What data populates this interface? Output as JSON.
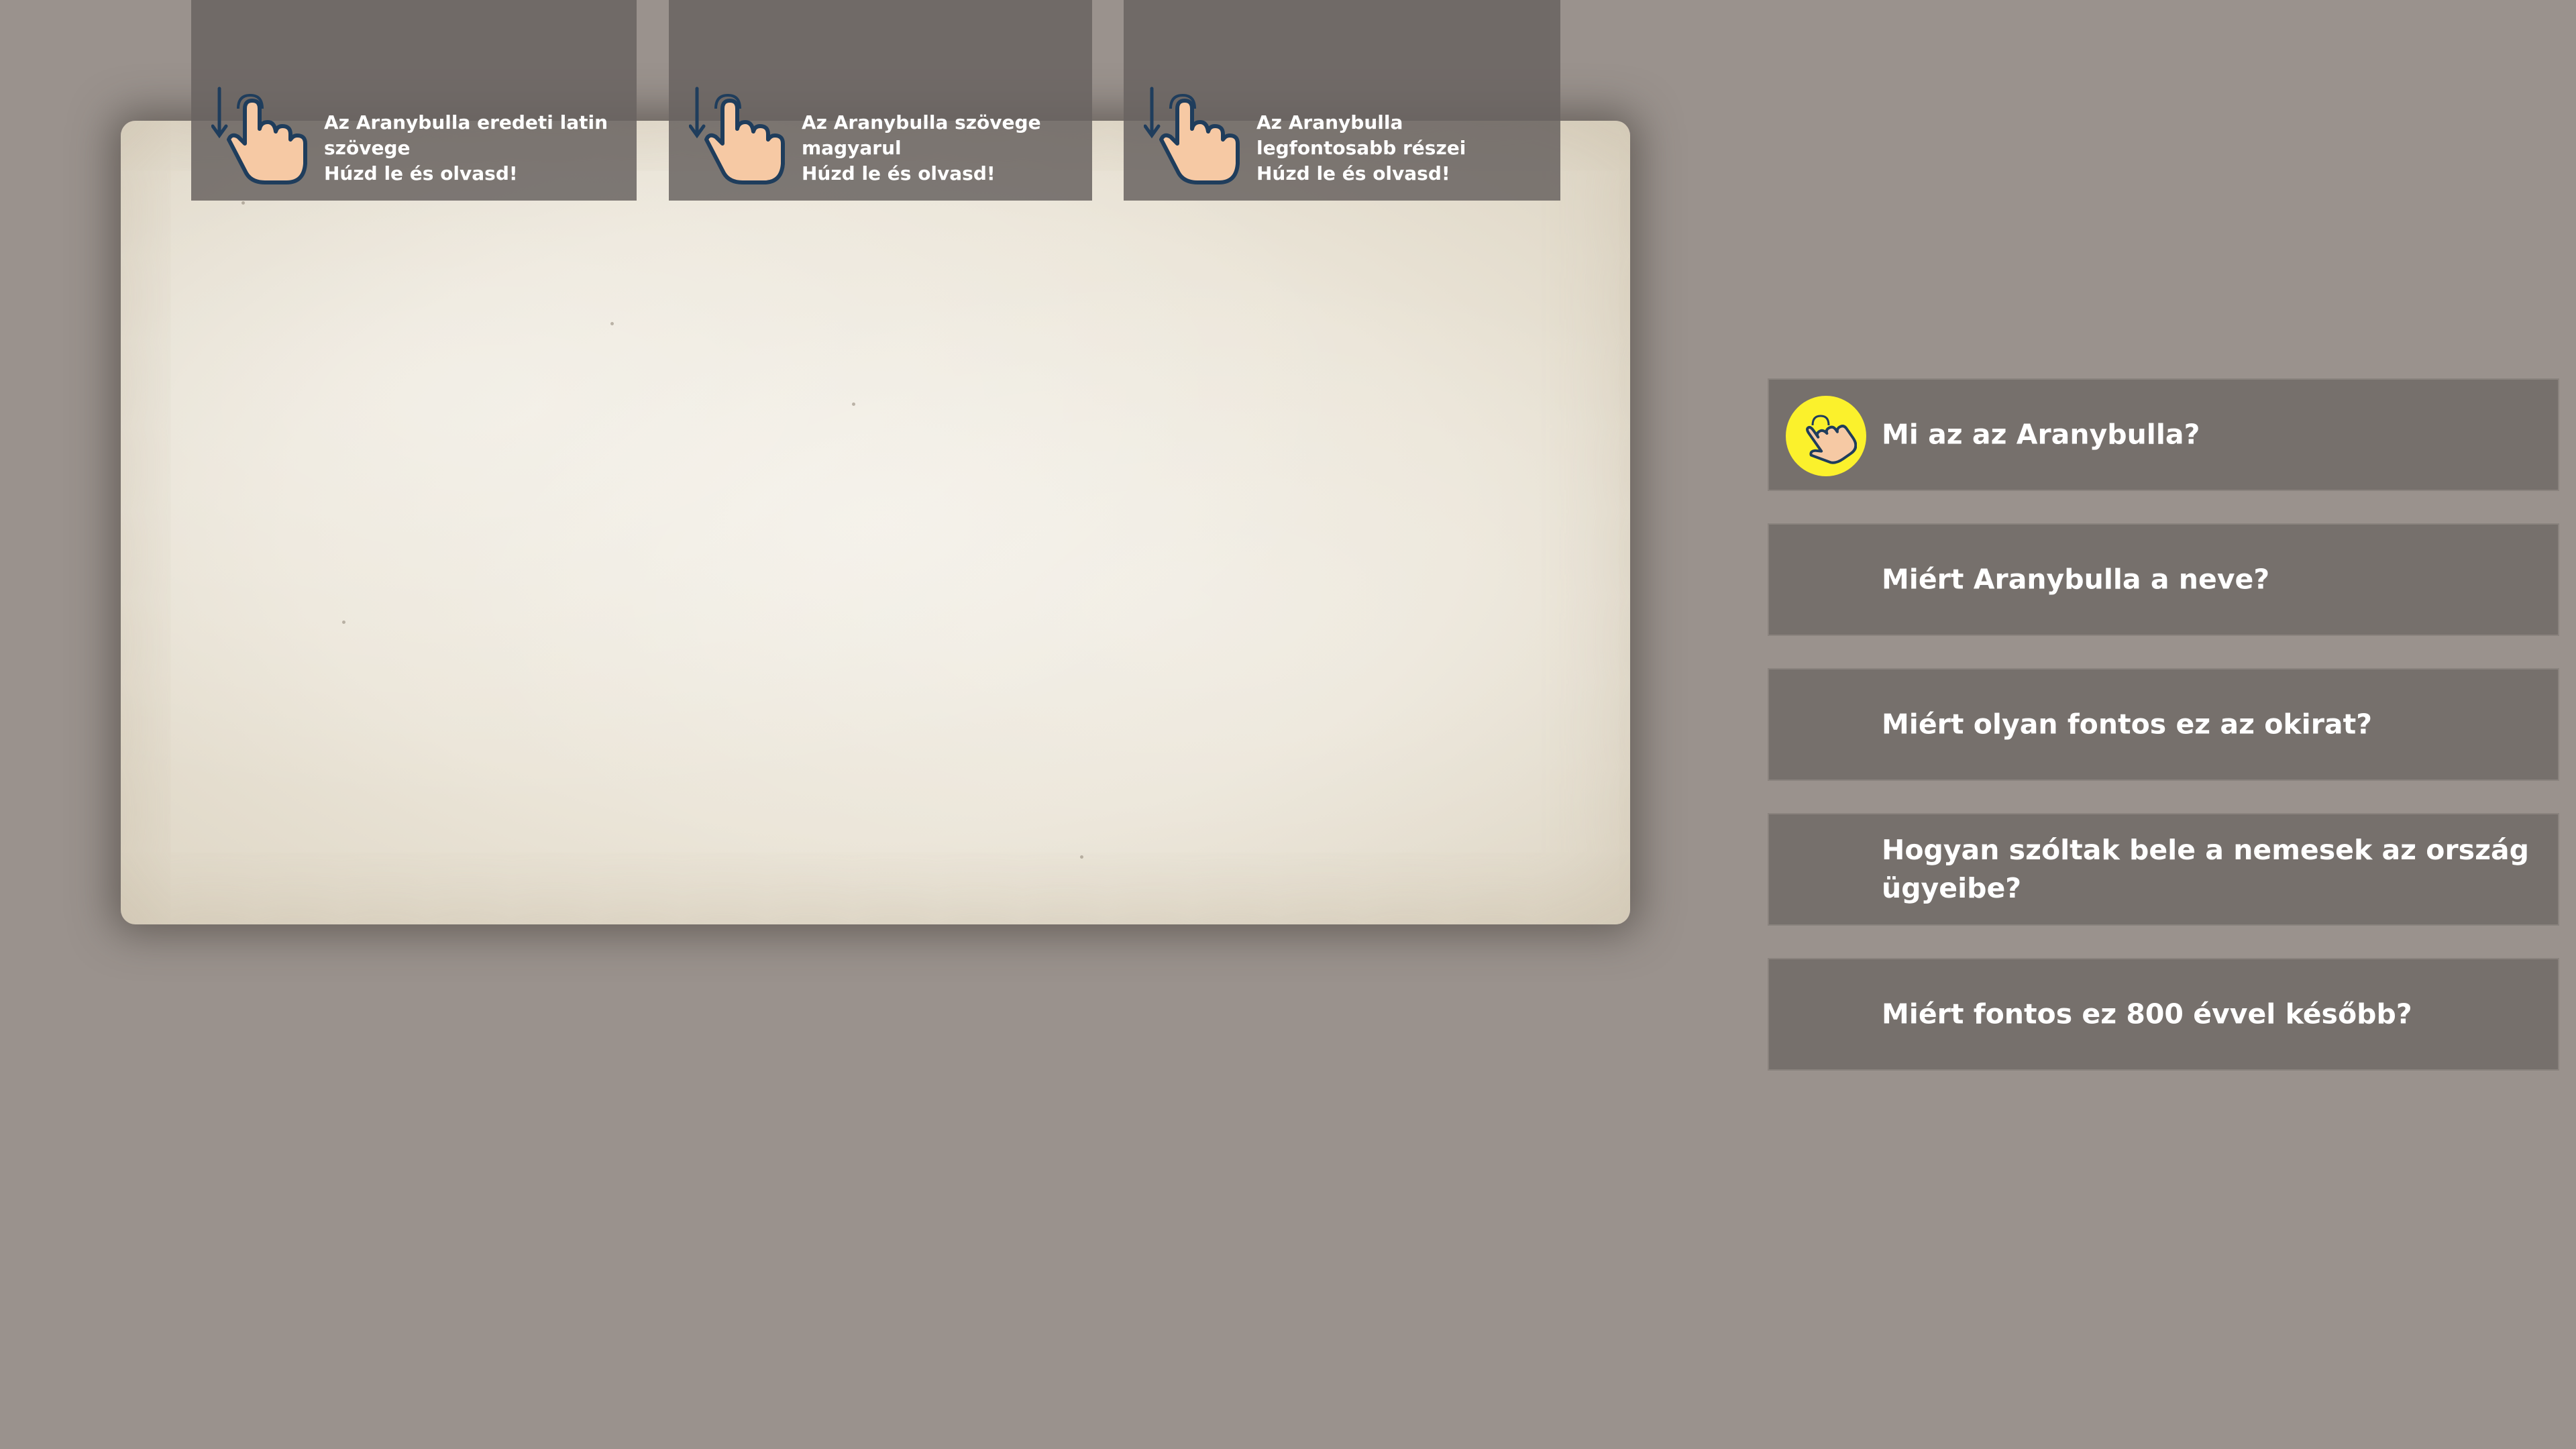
{
  "colors": {
    "background": "#9a928d",
    "tab_bg": "#6b6461",
    "button_bg": "#76706c",
    "badge": "#fbf12c",
    "hand_fill": "#f6c9a4",
    "hand_outline": "#1f3d5c"
  },
  "tabs": [
    {
      "title": "Az Aranybulla eredeti latin szövege",
      "hint": "Húzd le és olvasd!",
      "icon": "swipe-down-hand-icon"
    },
    {
      "title": "Az Aranybulla szövege magyarul",
      "hint": "Húzd le és olvasd!",
      "icon": "swipe-down-hand-icon"
    },
    {
      "title": "Az Aranybulla legfontosabb részei",
      "hint": "Húzd le és olvasd!",
      "icon": "swipe-down-hand-icon"
    }
  ],
  "questions": [
    {
      "label": "Mi az az Aranybulla?",
      "active": true,
      "icon": "tap-hand-icon"
    },
    {
      "label": "Miért Aranybulla a neve?"
    },
    {
      "label": "Miért olyan fontos ez az okirat?"
    },
    {
      "label": "Hogyan szóltak bele a nemesek az ország ügyeibe?"
    },
    {
      "label": "Miért fontos ez 800 évvel később?"
    }
  ]
}
